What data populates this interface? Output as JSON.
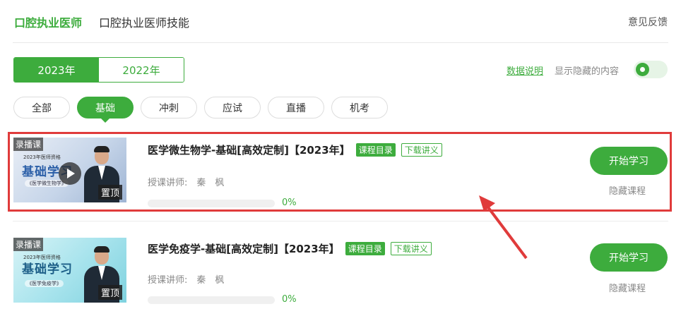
{
  "header": {
    "tabs": [
      {
        "label": "口腔执业医师",
        "active": true
      },
      {
        "label": "口腔执业医师技能",
        "active": false
      }
    ],
    "feedback": "意见反馈"
  },
  "years": [
    {
      "label": "2023年",
      "active": true
    },
    {
      "label": "2022年",
      "active": false
    }
  ],
  "settings": {
    "data_note": "数据说明",
    "show_hidden_label": "显示隐藏的内容",
    "show_hidden_on": true
  },
  "filters": [
    {
      "label": "全部",
      "active": false
    },
    {
      "label": "基础",
      "active": true
    },
    {
      "label": "冲刺",
      "active": false
    },
    {
      "label": "应试",
      "active": false
    },
    {
      "label": "直播",
      "active": false
    },
    {
      "label": "机考",
      "active": false
    }
  ],
  "courses": [
    {
      "title": "医学微生物学-基础[高效定制]【2023年】",
      "catalog_label": "课程目录",
      "handout_label": "下载讲义",
      "teacher": "授课讲师:　秦　枫",
      "progress": 0,
      "progress_text": "0%",
      "start_label": "开始学习",
      "hide_label": "隐藏课程",
      "thumb": {
        "tag": "录播课",
        "subtitle": "2023年医师资格",
        "title": "基础学习",
        "course": "《医学微生物学》",
        "pin": "置顶"
      }
    },
    {
      "title": "医学免疫学-基础[高效定制]【2023年】",
      "catalog_label": "课程目录",
      "handout_label": "下载讲义",
      "teacher": "授课讲师:　秦　枫",
      "progress": 0,
      "progress_text": "0%",
      "start_label": "开始学习",
      "hide_label": "隐藏课程",
      "thumb": {
        "tag": "录播课",
        "subtitle": "2023年医师资格",
        "title": "基础学习",
        "course": "《医学免疫学》",
        "pin": "置顶"
      }
    }
  ],
  "colors": {
    "accent": "#3dac3d",
    "annotation": "#e03b3b"
  }
}
